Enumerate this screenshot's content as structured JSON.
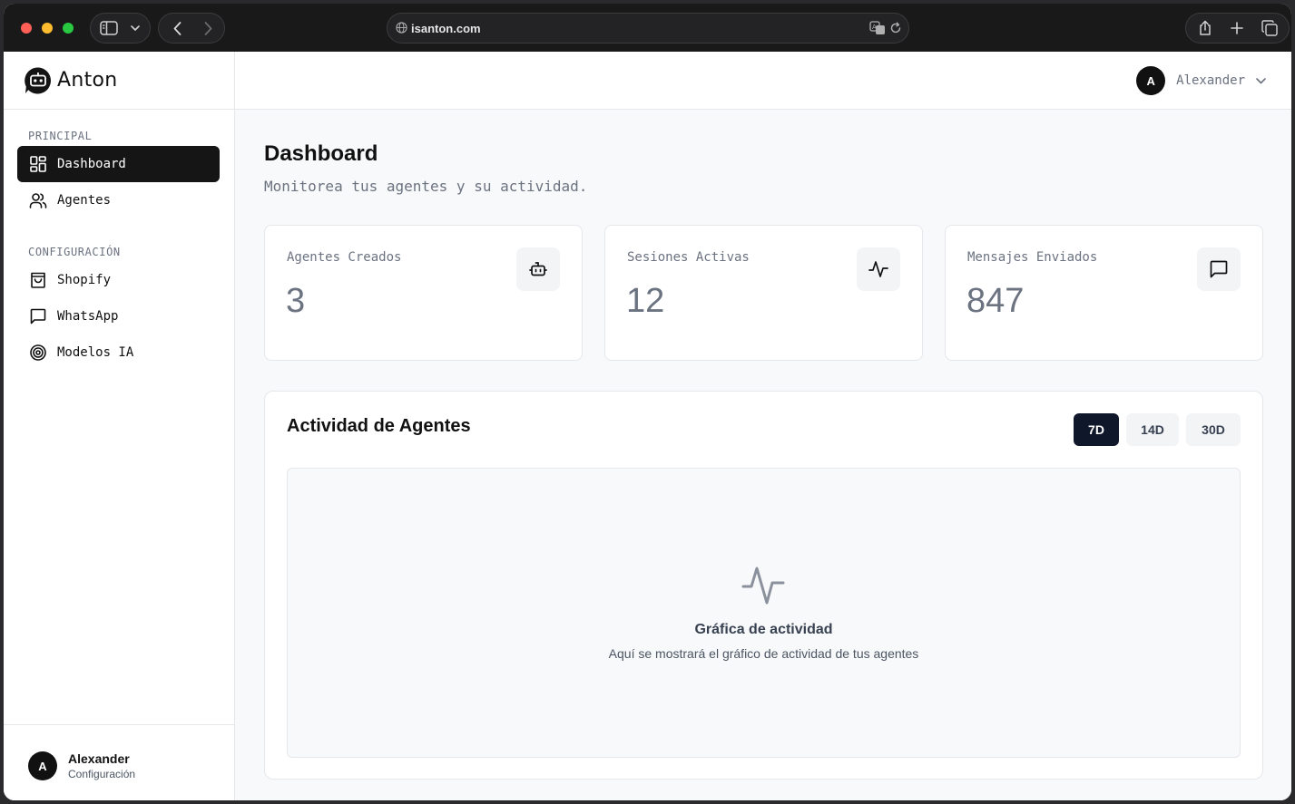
{
  "browser": {
    "url": "isanton.com"
  },
  "brand": {
    "name": "Anton"
  },
  "sidebar": {
    "sections": [
      {
        "label": "PRINCIPAL",
        "items": [
          {
            "label": "Dashboard",
            "icon": "layout-dashboard-icon",
            "active": true
          },
          {
            "label": "Agentes",
            "icon": "users-icon",
            "active": false
          }
        ]
      },
      {
        "label": "CONFIGURACIÓN",
        "items": [
          {
            "label": "Shopify",
            "icon": "shopping-bag-icon",
            "active": false
          },
          {
            "label": "WhatsApp",
            "icon": "message-square-icon",
            "active": false
          },
          {
            "label": "Modelos IA",
            "icon": "target-icon",
            "active": false
          }
        ]
      }
    ],
    "footer": {
      "avatar_initial": "A",
      "name": "Alexander",
      "subtitle": "Configuración"
    }
  },
  "topbar": {
    "avatar_initial": "A",
    "user_name": "Alexander"
  },
  "page": {
    "title": "Dashboard",
    "subtitle": "Monitorea tus agentes y su actividad."
  },
  "stats": [
    {
      "label": "Agentes Creados",
      "value": "3",
      "icon": "bot-icon"
    },
    {
      "label": "Sesiones Activas",
      "value": "12",
      "icon": "activity-icon"
    },
    {
      "label": "Mensajes Enviados",
      "value": "847",
      "icon": "message-square-icon"
    }
  ],
  "activity": {
    "title": "Actividad de Agentes",
    "ranges": [
      "7D",
      "14D",
      "30D"
    ],
    "selected_range": "7D",
    "empty_title": "Gráfica de actividad",
    "empty_subtitle": "Aquí se mostrará el gráfico de actividad de tus agentes"
  },
  "colors": {
    "active_nav": "#151515",
    "accent_button": "#0f172a",
    "muted_text": "#6b7280",
    "background": "#f8f9fa"
  }
}
